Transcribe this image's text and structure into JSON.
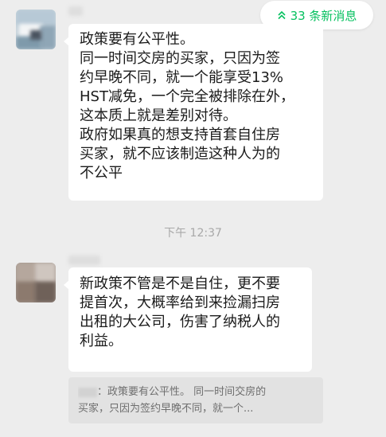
{
  "new_messages": {
    "label": "33 条新消息",
    "accent_color": "#07C160",
    "icon": "double-chevron-up-icon"
  },
  "messages": [
    {
      "lines": [
        "政策要有公平性。",
        "同一时间交房的买家，只因为签",
        "约早晚不同，就一个能享受13%",
        "HST减免，一个完全被排除在外，",
        "这本质上就是差别对待。",
        "政府如果真的想支持首套自住房",
        "买家，就不应该制造这种人为的",
        "不公平"
      ]
    },
    {
      "lines": [
        "新政策不管是不是自住，更不要",
        "提首次，大概率给到来捡漏扫房",
        "出租的大公司，伤害了纳税人的",
        "利益。"
      ],
      "quote": {
        "line1": "：政策要有公平性。 同一时间交房的",
        "line2": "买家，只因为签约早晚不同，就一个..."
      }
    }
  ],
  "timestamp": "下午 12:37"
}
